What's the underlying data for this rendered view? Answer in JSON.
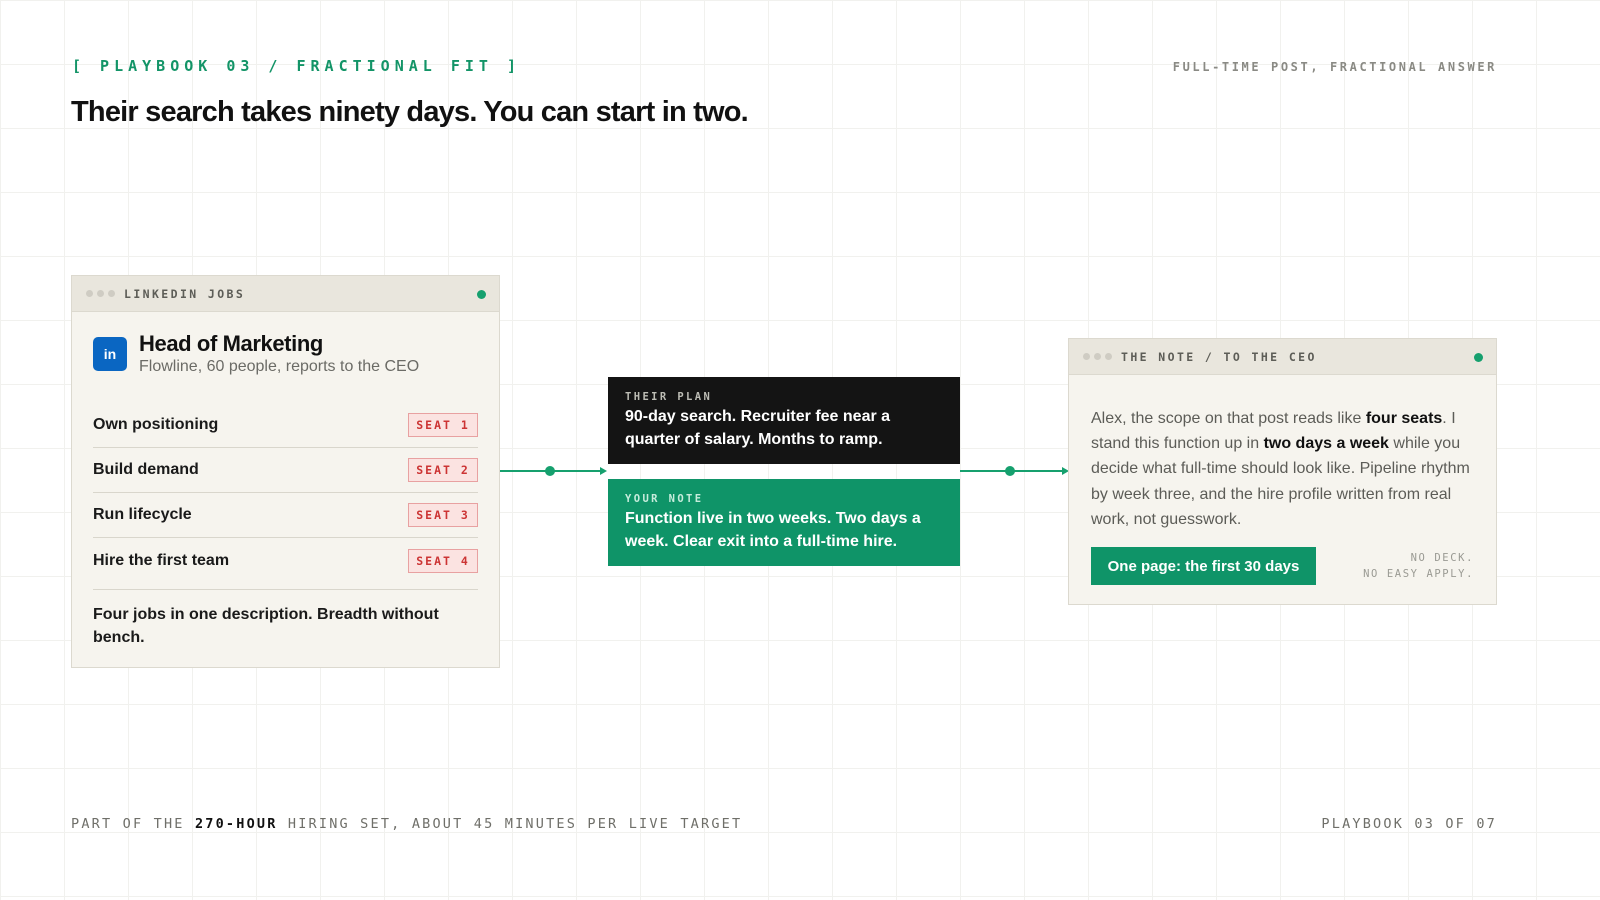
{
  "header": {
    "eyebrow": "[ PLAYBOOK 03 / FRACTIONAL FIT ]",
    "tagline": "FULL-TIME POST, FRACTIONAL ANSWER",
    "headline": "Their search takes ninety days. You can start in two."
  },
  "job_card": {
    "window_title": "LINKEDIN JOBS",
    "badge": "in",
    "title": "Head of Marketing",
    "subtitle": "Flowline, 60 people, reports to the CEO",
    "seats": [
      {
        "label": "Own positioning",
        "tag": "SEAT 1"
      },
      {
        "label": "Build demand",
        "tag": "SEAT 2"
      },
      {
        "label": "Run lifecycle",
        "tag": "SEAT 3"
      },
      {
        "label": "Hire the first team",
        "tag": "SEAT 4"
      }
    ],
    "footer": "Four jobs in one description. Breadth without bench."
  },
  "plan": {
    "kicker": "THEIR PLAN",
    "text": "90-day search. Recruiter fee near a quarter of salary. Months to ramp."
  },
  "your_note": {
    "kicker": "YOUR NOTE",
    "text": "Function live in two weeks. Two days a week. Clear exit into a full-time hire."
  },
  "note_card": {
    "window_title": "THE NOTE / TO THE CEO",
    "body": {
      "p1": "Alex, the scope on that post reads like ",
      "b1": "four seats",
      "p2": ". I stand this function up in ",
      "b2": "two days a week",
      "p3": " while you decide what full-time should look like. Pipeline rhythm by week three, and the hire profile written from real work, not guesswork."
    },
    "cta": "One page: the first 30 days",
    "fine_1": "NO DECK.",
    "fine_2": "NO EASY APPLY."
  },
  "footer": {
    "left_pre": "PART OF THE ",
    "left_bold": "270-HOUR",
    "left_post": " HIRING SET, ABOUT 45 MINUTES PER LIVE TARGET",
    "right": "PLAYBOOK 03 OF 07"
  },
  "colors": {
    "accent": "#0f9468",
    "linkedin": "#0a66c2",
    "seat_tag": "#cc3434",
    "dark_block": "#141414"
  }
}
